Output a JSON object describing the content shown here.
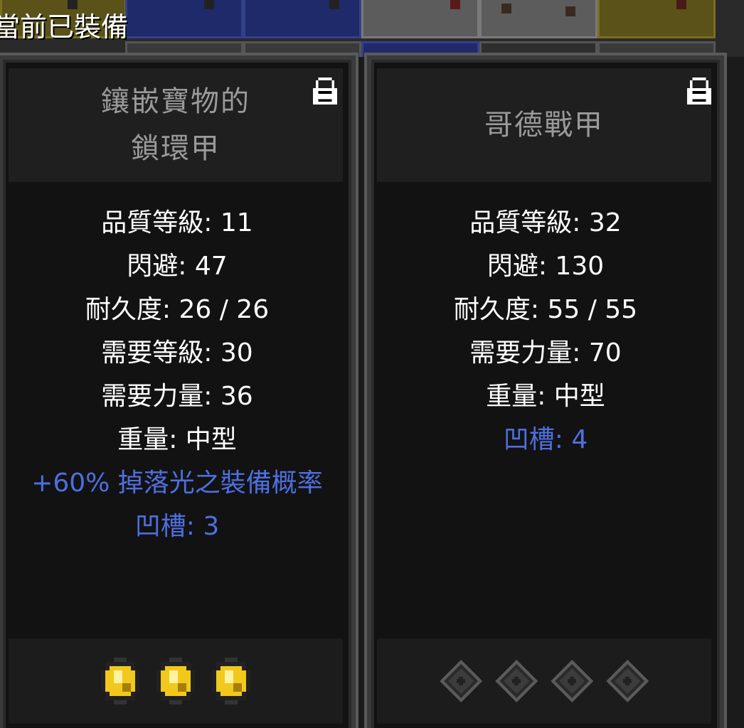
{
  "header_label": "當前已裝備",
  "panels": [
    {
      "title": "鑲嵌寶物的\n鎖環甲",
      "stats": [
        {
          "text": "品質等級: 11",
          "kind": "normal"
        },
        {
          "text": "閃避: 47",
          "kind": "normal"
        },
        {
          "text": "耐久度: 26 / 26",
          "kind": "normal"
        },
        {
          "text": "需要等級: 30",
          "kind": "normal"
        },
        {
          "text": "需要力量: 36",
          "kind": "normal"
        },
        {
          "text": "重量: 中型",
          "kind": "normal"
        },
        {
          "text": "+60% 掉落光之裝備概率",
          "kind": "magic"
        },
        {
          "text": "凹槽: 3",
          "kind": "magic"
        }
      ],
      "sockets": [
        "gold-gem-icon",
        "gold-gem-icon",
        "gold-gem-icon"
      ]
    },
    {
      "title": "哥德戰甲",
      "stats": [
        {
          "text": "品質等級: 32",
          "kind": "normal"
        },
        {
          "text": "閃避: 130",
          "kind": "normal"
        },
        {
          "text": "耐久度: 55 / 55",
          "kind": "normal"
        },
        {
          "text": "需要力量: 70",
          "kind": "normal"
        },
        {
          "text": "重量: 中型",
          "kind": "normal"
        },
        {
          "text": "凹槽: 4",
          "kind": "magic"
        }
      ],
      "sockets": [
        "empty-socket-icon",
        "empty-socket-icon",
        "empty-socket-icon",
        "empty-socket-icon"
      ]
    }
  ],
  "colors": {
    "stat_normal": "#ffffff",
    "stat_magic": "#4e6fe0",
    "title": "#9a9a9a",
    "gem_gold": "#f2c81c",
    "socket_empty": "#3c3c3c"
  }
}
